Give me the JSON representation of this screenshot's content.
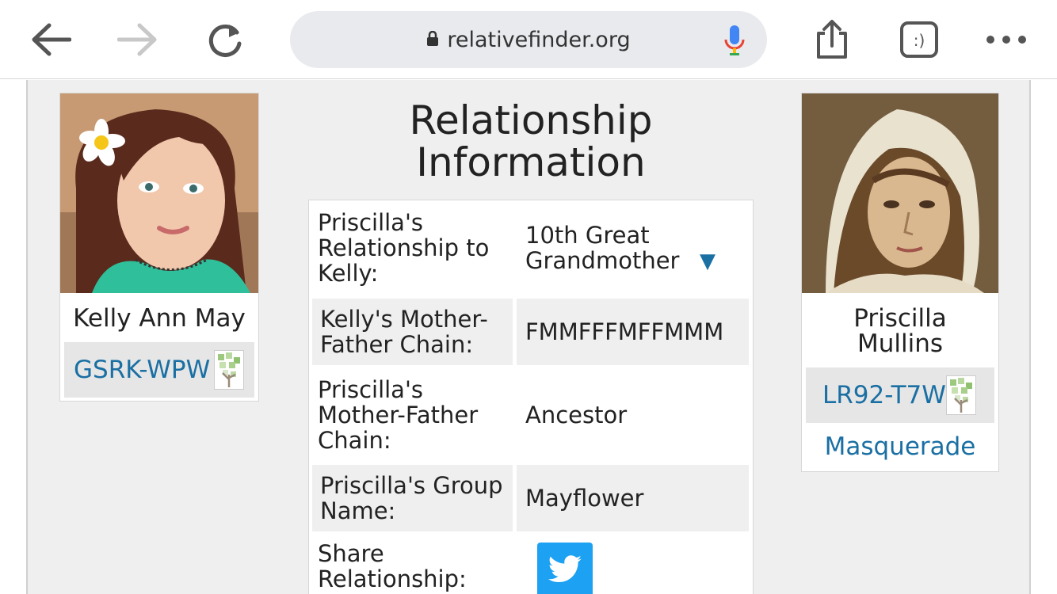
{
  "browser": {
    "url": "relativefinder.org",
    "tabs_icon_label": ":)"
  },
  "page": {
    "title": "Relationship Information",
    "left_person": {
      "name": "Kelly Ann May",
      "id": "GSRK-WPW"
    },
    "right_person": {
      "name": "Priscilla Mullins",
      "id": "LR92-T7W",
      "group_link": "Masquerade"
    },
    "table": {
      "rows": [
        {
          "label": "Priscilla's Relationship to Kelly:",
          "value": "10th Great Grandmother"
        },
        {
          "label": "Kelly's Mother-Father Chain:",
          "value": "FMMFFFMFFMMM"
        },
        {
          "label": "Priscilla's Mother-Father Chain:",
          "value": "Ancestor"
        },
        {
          "label": "Priscilla's Group Name:",
          "value": "Mayflower"
        },
        {
          "label": "Share Relationship:",
          "value": ""
        }
      ]
    }
  },
  "colors": {
    "link": "#1a6fa3",
    "twitter": "#1da1f2",
    "page_bg": "#efefef"
  },
  "icons": [
    "back-arrow-icon",
    "forward-arrow-icon",
    "reload-icon",
    "lock-icon",
    "mic-icon",
    "share-icon",
    "tabs-icon",
    "more-icon",
    "family-tree-icon",
    "twitter-icon",
    "dropdown-triangle-icon"
  ]
}
